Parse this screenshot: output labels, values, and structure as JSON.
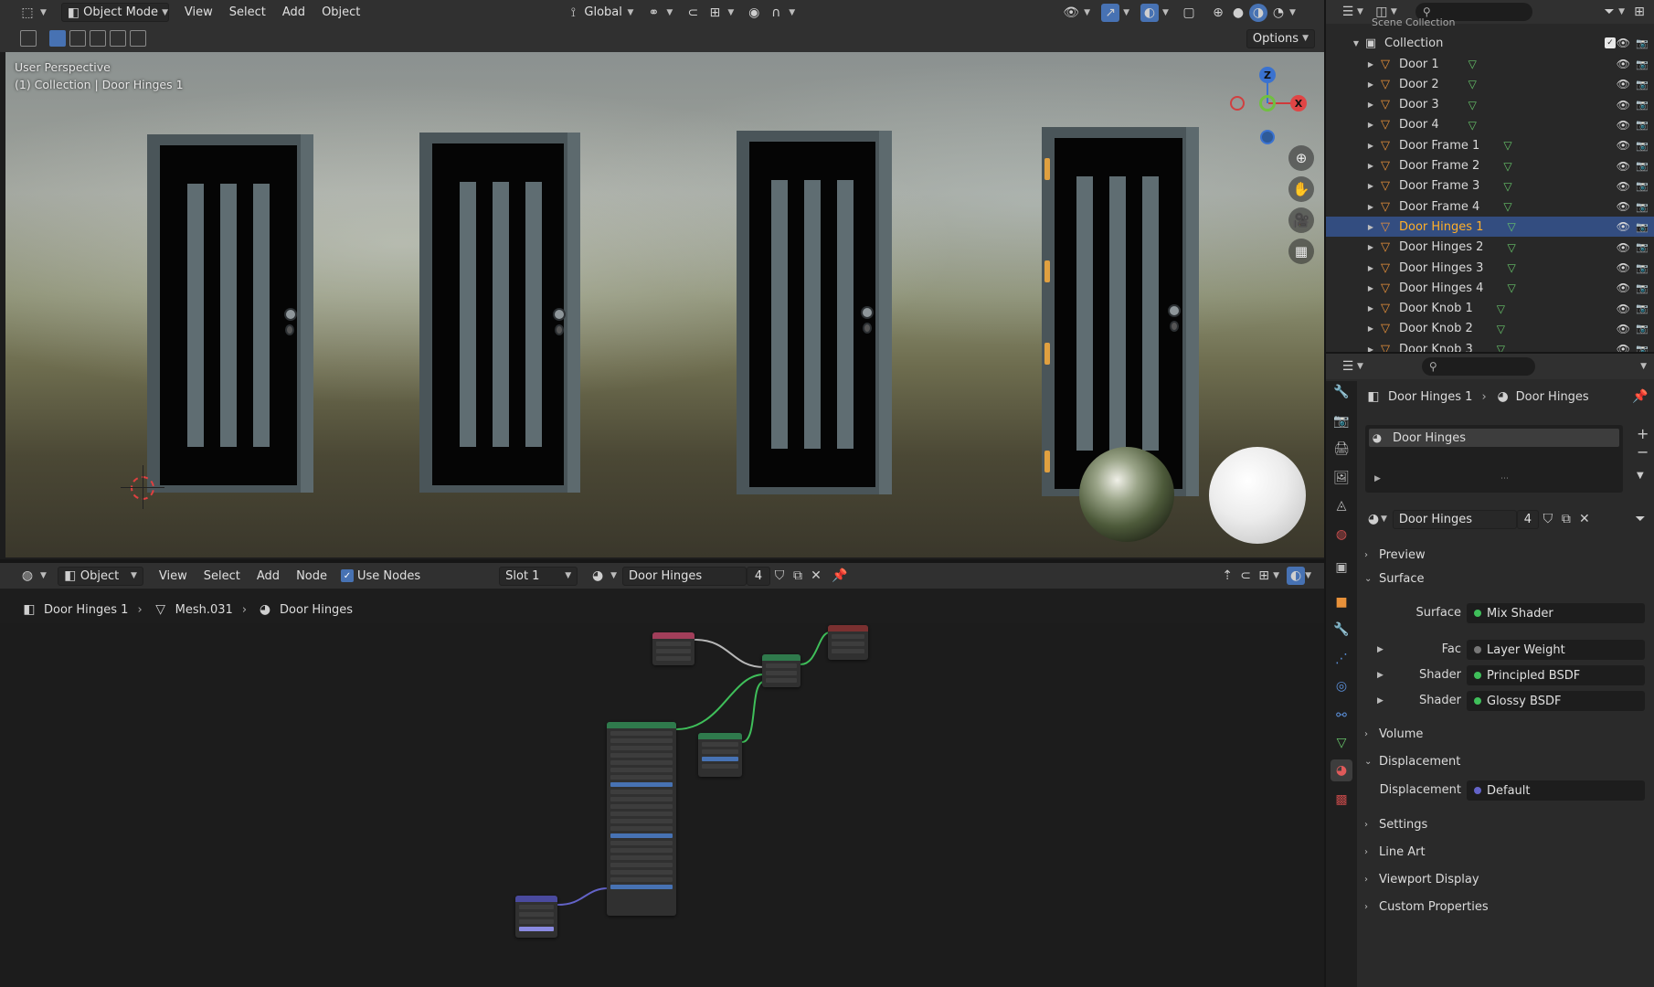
{
  "viewport_header": {
    "mode": "Object Mode",
    "menus": [
      "View",
      "Select",
      "Add",
      "Object"
    ],
    "transform_orientation": "Global",
    "options_label": "Options"
  },
  "viewport": {
    "perspective_label": "User Perspective",
    "context_label": "(1) Collection | Door Hinges 1",
    "gizmo": {
      "z": "Z",
      "x": "X"
    }
  },
  "node_header": {
    "mode": "Object",
    "menus": [
      "View",
      "Select",
      "Add",
      "Node"
    ],
    "use_nodes_label": "Use Nodes",
    "slot": "Slot 1",
    "material": "Door Hinges",
    "users": "4"
  },
  "node_breadcrumb": {
    "object": "Door Hinges 1",
    "mesh": "Mesh.031",
    "material": "Door Hinges"
  },
  "outliner": {
    "scene_collection": "Scene Collection",
    "collection": "Collection",
    "items": [
      {
        "label": "Door 1"
      },
      {
        "label": "Door 2"
      },
      {
        "label": "Door 3"
      },
      {
        "label": "Door 4"
      },
      {
        "label": "Door Frame 1"
      },
      {
        "label": "Door Frame 2"
      },
      {
        "label": "Door Frame 3"
      },
      {
        "label": "Door Frame 4"
      },
      {
        "label": "Door Hinges 1",
        "selected": true
      },
      {
        "label": "Door Hinges 2"
      },
      {
        "label": "Door Hinges 3"
      },
      {
        "label": "Door Hinges 4"
      },
      {
        "label": "Door Knob 1"
      },
      {
        "label": "Door Knob 2"
      },
      {
        "label": "Door Knob 3"
      }
    ]
  },
  "properties": {
    "breadcrumb_object": "Door Hinges 1",
    "breadcrumb_material": "Door Hinges",
    "slot_item": "Door Hinges",
    "material_name": "Door Hinges",
    "material_users": "4",
    "sections": {
      "preview": "Preview",
      "surface": "Surface",
      "volume": "Volume",
      "displacement": "Displacement",
      "settings": "Settings",
      "line_art": "Line Art",
      "viewport_display": "Viewport Display",
      "custom_properties": "Custom Properties"
    },
    "surface_label": "Surface",
    "surface_value": "Mix Shader",
    "fac_label": "Fac",
    "fac_value": "Layer Weight",
    "shader1_label": "Shader",
    "shader1_value": "Principled BSDF",
    "shader2_label": "Shader",
    "shader2_value": "Glossy BSDF",
    "displacement_label": "Displacement",
    "displacement_value": "Default"
  },
  "colors": {
    "accent": "#4772b3",
    "selected_row": "#334d80",
    "selected_text": "#ffaf29",
    "object_icon": "#e8913a",
    "mesh_icon": "#67c46a",
    "shader_socket": "#3fbf5a",
    "vector_socket": "#6363c7"
  }
}
